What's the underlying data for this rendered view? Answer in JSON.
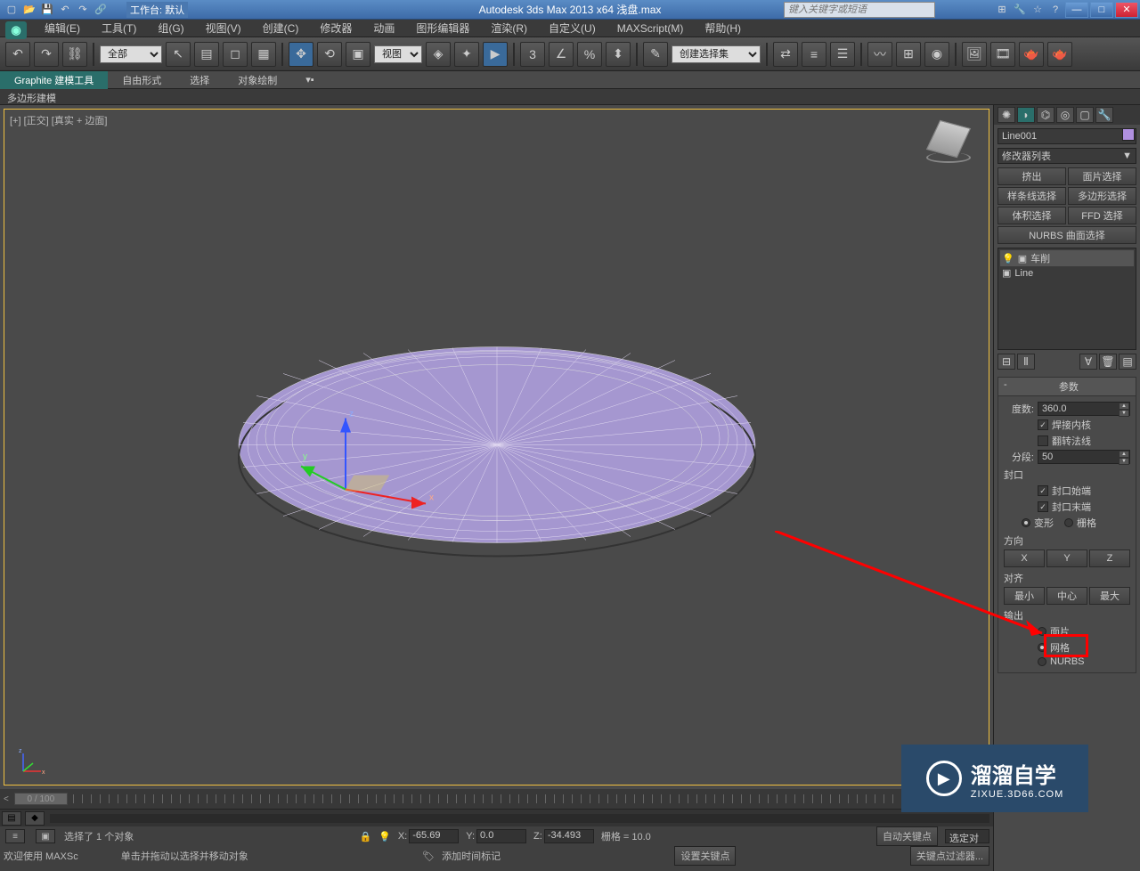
{
  "title_bar": {
    "workspace_label": "工作台: 默认",
    "app_title": "Autodesk 3ds Max  2013 x64    浅盘.max",
    "search_placeholder": "键入关键字或短语"
  },
  "menu": {
    "items": [
      "编辑(E)",
      "工具(T)",
      "组(G)",
      "视图(V)",
      "创建(C)",
      "修改器",
      "动画",
      "图形编辑器",
      "渲染(R)",
      "自定义(U)",
      "MAXScript(M)",
      "帮助(H)"
    ]
  },
  "main_toolbar": {
    "filter_dropdown": "全部",
    "view_dropdown": "视图",
    "selset_dropdown": "创建选择集"
  },
  "ribbon": {
    "tabs": [
      "Graphite 建模工具",
      "自由形式",
      "选择",
      "对象绘制"
    ],
    "sub": "多边形建模"
  },
  "viewport": {
    "label": "[+] [正交] [真实 + 边面]"
  },
  "right_panel": {
    "object_name": "Line001",
    "modifier_list_label": "修改器列表",
    "buttons": [
      "挤出",
      "面片选择",
      "样条线选择",
      "多边形选择",
      "体积选择",
      "FFD 选择"
    ],
    "nurbs_btn": "NURBS 曲面选择",
    "stack": {
      "item1": "车削",
      "item2": "Line"
    },
    "rollout_params": {
      "header": "参数",
      "degrees_label": "度数:",
      "degrees_value": "360.0",
      "weld_label": "焊接内核",
      "flip_label": "翻转法线",
      "segments_label": "分段:",
      "segments_value": "50",
      "cap_label": "封口",
      "cap_start": "封口始端",
      "cap_end": "封口末端",
      "morph": "变形",
      "grid": "栅格",
      "direction_label": "方向",
      "dir_x": "X",
      "dir_y": "Y",
      "dir_z": "Z",
      "align_label": "对齐",
      "align_min": "最小",
      "align_center": "中心",
      "align_max": "最大",
      "output_label": "输出",
      "out_patch": "面片",
      "out_mesh": "网格",
      "out_nurbs": "NURBS"
    }
  },
  "timeline": {
    "slider": "0 / 100"
  },
  "status": {
    "selection": "选择了 1 个对象",
    "prompt": "单击并拖动以选择并移动对象",
    "x_label": "X:",
    "x_val": "-65.69",
    "y_label": "Y:",
    "y_val": "0.0",
    "z_label": "Z:",
    "z_val": "-34.493",
    "grid_label": "栅格 = 10.0",
    "autokey": "自动关键点",
    "selkey": "选定对",
    "welcome": "欢迎使用  MAXSc",
    "addtimetag": "添加时间标记",
    "setkey": "设置关键点",
    "keyfilters": "关键点过滤器..."
  },
  "watermark": {
    "main": "溜溜自学",
    "sub": "ZIXUE.3D66.COM"
  }
}
